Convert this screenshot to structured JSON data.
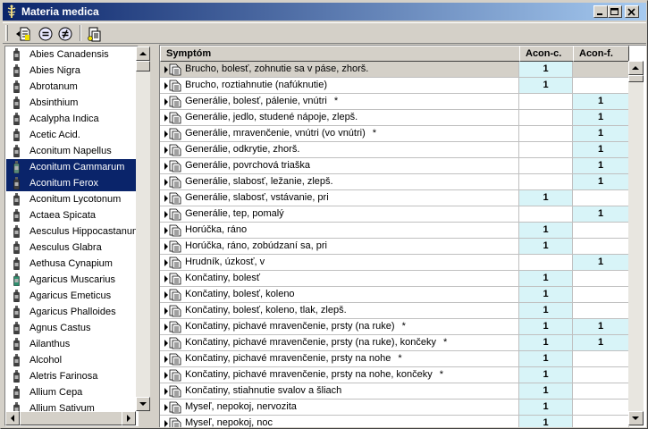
{
  "window": {
    "title": "Materia medica"
  },
  "toolbar": {
    "tools": [
      "add-document-icon",
      "equal-icon",
      "not-equal-icon",
      "compare-icon"
    ]
  },
  "remedies": [
    {
      "name": "Abies Canadensis",
      "selected": false,
      "color": "#404040"
    },
    {
      "name": "Abies Nigra",
      "selected": false,
      "color": "#404040"
    },
    {
      "name": "Abrotanum",
      "selected": false,
      "color": "#404040"
    },
    {
      "name": "Absinthium",
      "selected": false,
      "color": "#404040"
    },
    {
      "name": "Acalypha Indica",
      "selected": false,
      "color": "#404040"
    },
    {
      "name": "Acetic Acid.",
      "selected": false,
      "color": "#404040"
    },
    {
      "name": "Aconitum Napellus",
      "selected": false,
      "color": "#404040"
    },
    {
      "name": "Aconitum Cammarum",
      "selected": true,
      "color": "#5a8a7a"
    },
    {
      "name": "Aconitum Ferox",
      "selected": true,
      "color": "#404040"
    },
    {
      "name": "Aconitum Lycotonum",
      "selected": false,
      "color": "#404040"
    },
    {
      "name": "Actaea Spicata",
      "selected": false,
      "color": "#404040"
    },
    {
      "name": "Aesculus Hippocastanum",
      "selected": false,
      "color": "#404040"
    },
    {
      "name": "Aesculus Glabra",
      "selected": false,
      "color": "#404040"
    },
    {
      "name": "Aethusa Cynapium",
      "selected": false,
      "color": "#404040"
    },
    {
      "name": "Agaricus Muscarius",
      "selected": false,
      "color": "#2f8f6f"
    },
    {
      "name": "Agaricus Emeticus",
      "selected": false,
      "color": "#404040"
    },
    {
      "name": "Agaricus Phalloides",
      "selected": false,
      "color": "#404040"
    },
    {
      "name": "Agnus Castus",
      "selected": false,
      "color": "#404040"
    },
    {
      "name": "Ailanthus",
      "selected": false,
      "color": "#404040"
    },
    {
      "name": "Alcohol",
      "selected": false,
      "color": "#404040"
    },
    {
      "name": "Aletris Farinosa",
      "selected": false,
      "color": "#404040"
    },
    {
      "name": "Allium Cepa",
      "selected": false,
      "color": "#404040"
    },
    {
      "name": "Allium Sativum",
      "selected": false,
      "color": "#404040"
    }
  ],
  "grid": {
    "headers": {
      "symptom": "Symptóm",
      "col1": "Acon-c.",
      "col2": "Acon-f."
    },
    "rows": [
      {
        "symptom": "Brucho, bolesť, zohnutie sa v páse, zhorš.",
        "star": "",
        "c1": "1",
        "c2": ""
      },
      {
        "symptom": "Brucho, roztiahnutie (nafúknutie)",
        "star": "",
        "c1": "1",
        "c2": ""
      },
      {
        "symptom": "Generálie, bolesť, pálenie, vnútri",
        "star": "*",
        "c1": "",
        "c2": "1"
      },
      {
        "symptom": "Generálie, jedlo, studené nápoje, zlepš.",
        "star": "",
        "c1": "",
        "c2": "1"
      },
      {
        "symptom": "Generálie, mravenčenie, vnútri (vo vnútri)",
        "star": "*",
        "c1": "",
        "c2": "1"
      },
      {
        "symptom": "Generálie, odkrytie, zhorš.",
        "star": "",
        "c1": "",
        "c2": "1"
      },
      {
        "symptom": "Generálie, povrchová triaška",
        "star": "",
        "c1": "",
        "c2": "1"
      },
      {
        "symptom": "Generálie, slabosť, ležanie, zlepš.",
        "star": "",
        "c1": "",
        "c2": "1"
      },
      {
        "symptom": "Generálie, slabosť, vstávanie, pri",
        "star": "",
        "c1": "1",
        "c2": ""
      },
      {
        "symptom": "Generálie, tep, pomalý",
        "star": "",
        "c1": "",
        "c2": "1"
      },
      {
        "symptom": "Horúčka, ráno",
        "star": "",
        "c1": "1",
        "c2": ""
      },
      {
        "symptom": "Horúčka, ráno, zobúdzaní sa, pri",
        "star": "",
        "c1": "1",
        "c2": ""
      },
      {
        "symptom": "Hrudník, úzkosť, v",
        "star": "",
        "c1": "",
        "c2": "1"
      },
      {
        "symptom": "Končatiny, bolesť",
        "star": "",
        "c1": "1",
        "c2": ""
      },
      {
        "symptom": "Končatiny, bolesť, koleno",
        "star": "",
        "c1": "1",
        "c2": ""
      },
      {
        "symptom": "Končatiny, bolesť, koleno, tlak, zlepš.",
        "star": "",
        "c1": "1",
        "c2": ""
      },
      {
        "symptom": "Končatiny, pichavé mravenčenie, prsty (na ruke)",
        "star": "*",
        "c1": "1",
        "c2": "1"
      },
      {
        "symptom": "Končatiny, pichavé mravenčenie, prsty (na ruke), končeky",
        "star": "*",
        "c1": "1",
        "c2": "1"
      },
      {
        "symptom": "Končatiny, pichavé mravenčenie, prsty na nohe",
        "star": "*",
        "c1": "1",
        "c2": ""
      },
      {
        "symptom": "Končatiny, pichavé mravenčenie, prsty na nohe, končeky",
        "star": "*",
        "c1": "1",
        "c2": ""
      },
      {
        "symptom": "Končatiny, stiahnutie svalov a šliach",
        "star": "",
        "c1": "1",
        "c2": ""
      },
      {
        "symptom": "Myseľ, nepokoj, nervozita",
        "star": "",
        "c1": "1",
        "c2": ""
      },
      {
        "symptom": "Myseľ, nepokoj, noc",
        "star": "",
        "c1": "1",
        "c2": ""
      }
    ]
  }
}
